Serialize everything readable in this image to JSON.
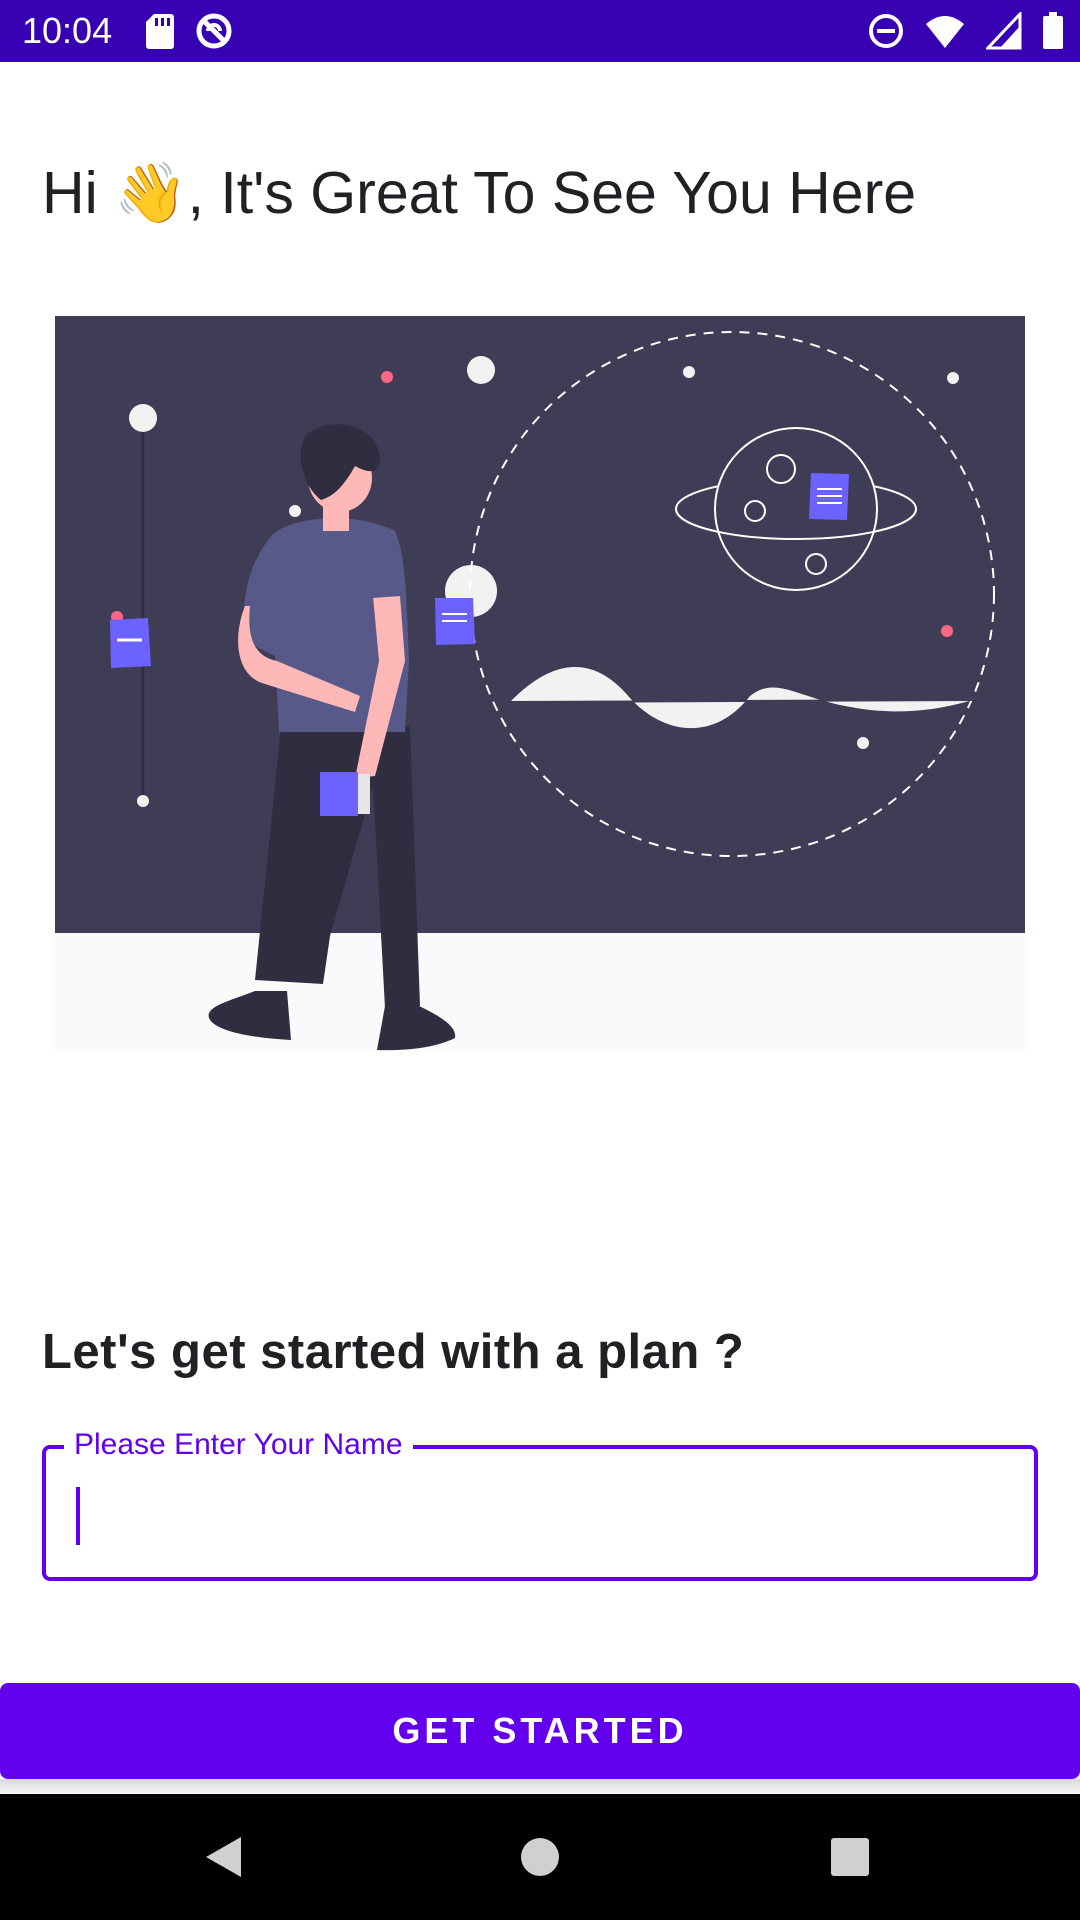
{
  "status_bar": {
    "time": "10:04",
    "left_icons": [
      "sd-card-icon",
      "sync-icon"
    ],
    "right_icons": [
      "do-not-disturb-icon",
      "wifi-icon",
      "signal-icon",
      "battery-icon"
    ]
  },
  "greeting": {
    "text": "Hi 👋, It's Great To See You Here"
  },
  "illustration": {
    "name": "person-viewing-planet-illustration",
    "colors": {
      "board": "#3f3d56",
      "accent": "#6c63ff",
      "skin": "#ffb8b8",
      "pink_dot": "#ff6584"
    }
  },
  "prompt": {
    "text": "Let's get started with a plan ?"
  },
  "name_field": {
    "label": "Please Enter Your Name",
    "value": ""
  },
  "button": {
    "label": "GET STARTED"
  },
  "nav_bar": {
    "icons": [
      "back-icon",
      "home-icon",
      "recents-icon"
    ]
  },
  "colors": {
    "status_bar": "#3700b3",
    "primary": "#6200ee",
    "text": "#202124"
  }
}
